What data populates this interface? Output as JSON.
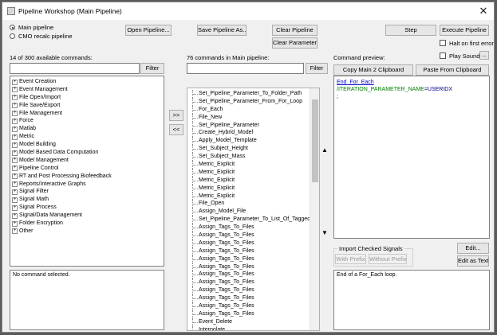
{
  "window": {
    "title": "Pipeline Workshop (Main Pipeline)",
    "close_glyph": "✕"
  },
  "modes": {
    "main": "Main pipeline",
    "cmo": "CMO recalc pipeline",
    "selected": "main"
  },
  "buttons": {
    "open": "Open Pipeline...",
    "save_as": "Save Pipeline As...",
    "clear_pipeline": "Clear Pipeline",
    "clear_parameters": "Clear Parameters",
    "step": "Step",
    "execute": "Execute Pipeline",
    "filter": "Filter",
    "add": ">>",
    "remove": "<<",
    "copy_main2": "Copy Main 2 Clipboard",
    "paste": "Paste From Clipboard",
    "ellipsis": "...",
    "edit": "Edit...",
    "edit_as_text": "Edit as Text"
  },
  "options": {
    "halt_label": "Halt on first error",
    "play_sound_label": "Play Sound"
  },
  "left": {
    "header": "14 of 300 available commands:",
    "filter_value": "",
    "categories": [
      "Event Creation",
      "Event Management",
      "File Open/Import",
      "File Save/Export",
      "File Management",
      "Force",
      "Matlab",
      "Metric",
      "Model Building",
      "Model Based Data Computation",
      "Model Management",
      "Pipeline Control",
      "RT and Post Processing Biofeedback",
      "Reports/Interactive Graphs",
      "Signal Filter",
      "Signal Math",
      "Signal Process",
      "Signal/Data Management",
      "Folder Encryption",
      "Other"
    ],
    "description": "No command selected."
  },
  "middle": {
    "header": "76 commands in Main pipeline:",
    "filter_value": "",
    "items": [
      "Set_Pipeline_Parameter_To_Folder_Path",
      "Set_Pipeline_Parameter_From_For_Loop",
      "For_Each",
      "File_New",
      "Set_Pipeline_Parameter",
      "Create_Hybrid_Model",
      "Apply_Model_Template",
      "Set_Subject_Height",
      "Set_Subject_Mass",
      "Metric_Explicit",
      "Metric_Explicit",
      "Metric_Explicit",
      "Metric_Explicit",
      "Metric_Explicit",
      "File_Open",
      "Assign_Model_File",
      "Set_Pipeline_Parameter_To_List_Of_Tagged_F",
      "Assign_Tags_To_Files",
      "Assign_Tags_To_Files",
      "Assign_Tags_To_Files",
      "Assign_Tags_To_Files",
      "Assign_Tags_To_Files",
      "Assign_Tags_To_Files",
      "Assign_Tags_To_Files",
      "Assign_Tags_To_Files",
      "Assign_Tags_To_Files",
      "Assign_Tags_To_Files",
      "Assign_Tags_To_Files",
      "Assign_Tags_To_Files",
      "Event_Delete",
      "Interpolate"
    ]
  },
  "right": {
    "header": "Command preview:",
    "preview_line1": "End_For_Each",
    "preview_key": "/ITERATION_PARAMETER_NAME",
    "preview_value": "=USERIDX",
    "preview_line3": ";",
    "import_group_label": "Import Checked Signals",
    "with_prefix": "With Prefix",
    "without_prefix": "Without Prefix",
    "description": "End of a For_Each loop."
  },
  "colors": {
    "preview_blue": "#0000c8",
    "preview_key": "#008000",
    "preview_value": "#000080"
  }
}
